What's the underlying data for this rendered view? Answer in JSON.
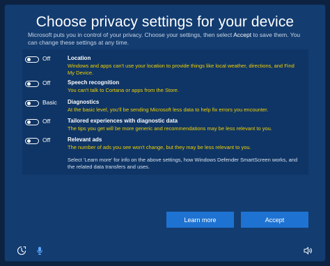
{
  "header": {
    "title": "Choose privacy settings for your device",
    "subtitle_part1": "Microsoft puts you in control of your privacy.  Choose your settings, then select ",
    "subtitle_accent": "Accept",
    "subtitle_part2": " to save them. You can change these settings at any time."
  },
  "settings": [
    {
      "state": "Off",
      "title": "Location",
      "desc": "Windows and apps can't use your location to provide things like local weather, directions, and Find My Device."
    },
    {
      "state": "Off",
      "title": "Speech recognition",
      "desc": "You can't talk to Cortana or apps from the Store."
    },
    {
      "state": "Basic",
      "title": "Diagnostics",
      "desc": "At the basic level, you'll be sending Microsoft less data to help fix errors you encounter."
    },
    {
      "state": "Off",
      "title": "Tailored experiences with diagnostic data",
      "desc": "The tips you get will be more generic and recommendations may be less relevant to you."
    },
    {
      "state": "Off",
      "title": "Relevant ads",
      "desc": "The number of ads you see won't change, but they may be less relevant to you."
    }
  ],
  "footer_note": "Select 'Learn more' for info on the above settings, how Windows Defender SmartScreen works, and the related data transfers and uses.",
  "buttons": {
    "learn_more": "Learn more",
    "accept": "Accept"
  },
  "icons": {
    "ease_of_access": "accessibility-icon",
    "microphone": "microphone-icon",
    "volume": "volume-icon"
  },
  "colors": {
    "background": "#133c70",
    "panel": "#0f3566",
    "description_text": "#f0d000",
    "button": "#1e73d2"
  }
}
